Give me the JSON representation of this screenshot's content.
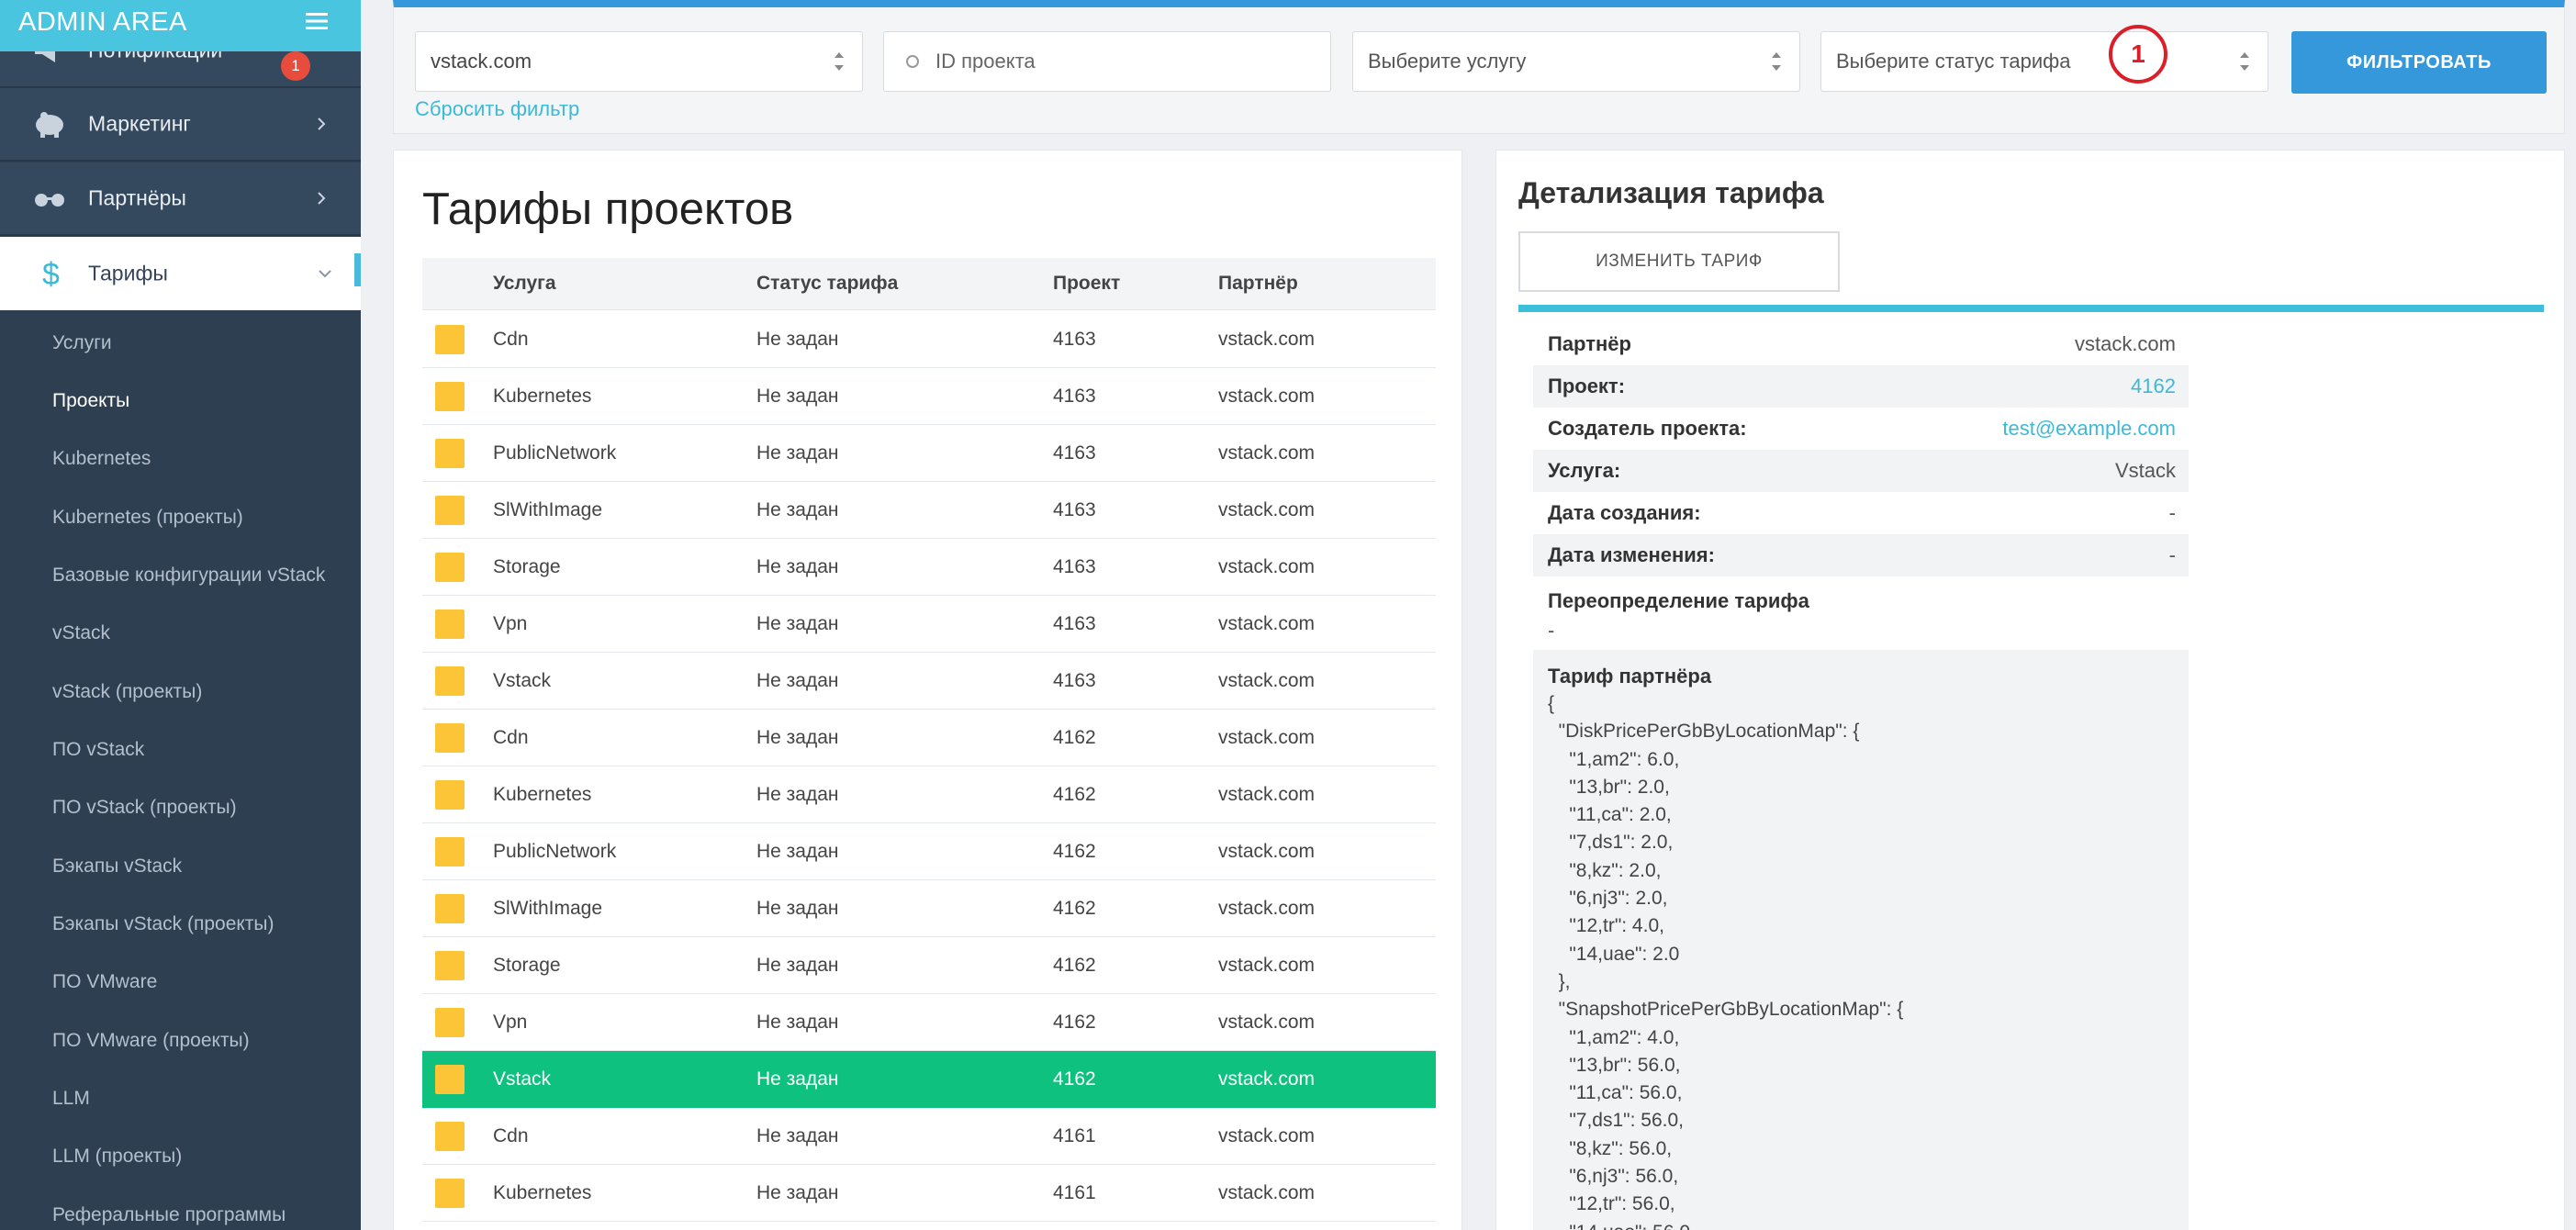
{
  "sidebar": {
    "header_title": "ADMIN AREA",
    "notifications": {
      "label": "Нотификации",
      "badge": "1"
    },
    "items": [
      {
        "label": "Маркетинг"
      },
      {
        "label": "Партнёры"
      },
      {
        "label": "Тарифы"
      }
    ],
    "sub_items": [
      "Услуги",
      "Проекты",
      "Kubernetes",
      "Kubernetes (проекты)",
      "Базовые конфигурации vStack",
      "vStack",
      "vStack (проекты)",
      "ПО vStack",
      "ПО vStack (проекты)",
      "Бэкапы vStack",
      "Бэкапы vStack (проекты)",
      "ПО VMware",
      "ПО VMware (проекты)",
      "LLM",
      "LLM (проекты)",
      "Реферальные программы"
    ]
  },
  "filter": {
    "partner_value": "vstack.com",
    "project_placeholder": "ID проекта",
    "service_placeholder": "Выберите услугу",
    "status_placeholder": "Выберите статус тарифа",
    "filter_button": "ФИЛЬТРОВАТЬ",
    "reset_link": "Сбросить фильтр",
    "marker_number": "1",
    "marker_color": "#d9202a"
  },
  "table": {
    "title": "Тарифы проектов",
    "headers": {
      "service": "Услуга",
      "status": "Статус тарифа",
      "project": "Проект",
      "partner": "Партнёр"
    },
    "selected_index": 13,
    "rows": [
      {
        "service": "Cdn",
        "status": "Не задан",
        "project": "4163",
        "partner": "vstack.com"
      },
      {
        "service": "Kubernetes",
        "status": "Не задан",
        "project": "4163",
        "partner": "vstack.com"
      },
      {
        "service": "PublicNetwork",
        "status": "Не задан",
        "project": "4163",
        "partner": "vstack.com"
      },
      {
        "service": "SlWithImage",
        "status": "Не задан",
        "project": "4163",
        "partner": "vstack.com"
      },
      {
        "service": "Storage",
        "status": "Не задан",
        "project": "4163",
        "partner": "vstack.com"
      },
      {
        "service": "Vpn",
        "status": "Не задан",
        "project": "4163",
        "partner": "vstack.com"
      },
      {
        "service": "Vstack",
        "status": "Не задан",
        "project": "4163",
        "partner": "vstack.com"
      },
      {
        "service": "Cdn",
        "status": "Не задан",
        "project": "4162",
        "partner": "vstack.com"
      },
      {
        "service": "Kubernetes",
        "status": "Не задан",
        "project": "4162",
        "partner": "vstack.com"
      },
      {
        "service": "PublicNetwork",
        "status": "Не задан",
        "project": "4162",
        "partner": "vstack.com"
      },
      {
        "service": "SlWithImage",
        "status": "Не задан",
        "project": "4162",
        "partner": "vstack.com"
      },
      {
        "service": "Storage",
        "status": "Не задан",
        "project": "4162",
        "partner": "vstack.com"
      },
      {
        "service": "Vpn",
        "status": "Не задан",
        "project": "4162",
        "partner": "vstack.com"
      },
      {
        "service": "Vstack",
        "status": "Не задан",
        "project": "4162",
        "partner": "vstack.com"
      },
      {
        "service": "Cdn",
        "status": "Не задан",
        "project": "4161",
        "partner": "vstack.com"
      },
      {
        "service": "Kubernetes",
        "status": "Не задан",
        "project": "4161",
        "partner": "vstack.com"
      }
    ]
  },
  "detail": {
    "title": "Детализация тарифа",
    "change_button": "ИЗМЕНИТЬ ТАРИФ",
    "fields": [
      {
        "key": "Партнёр",
        "value": "vstack.com",
        "link": false
      },
      {
        "key": "Проект:",
        "value": "4162",
        "link": true
      },
      {
        "key": "Создатель проекта:",
        "value": "test@example.com",
        "link": true
      },
      {
        "key": "Услуга:",
        "value": "Vstack",
        "link": false
      },
      {
        "key": "Дата создания:",
        "value": "-",
        "link": false
      },
      {
        "key": "Дата изменения:",
        "value": "-",
        "link": false
      }
    ],
    "override_label": "Переопределение тарифа",
    "override_value": "-",
    "partner_tariff_label": "Тариф партнёра",
    "partner_tariff_json": "{\n  \"DiskPricePerGbByLocationMap\": {\n    \"1,am2\": 6.0,\n    \"13,br\": 2.0,\n    \"11,ca\": 2.0,\n    \"7,ds1\": 2.0,\n    \"8,kz\": 2.0,\n    \"6,nj3\": 2.0,\n    \"12,tr\": 4.0,\n    \"14,uae\": 2.0\n  },\n  \"SnapshotPricePerGbByLocationMap\": {\n    \"1,am2\": 4.0,\n    \"13,br\": 56.0,\n    \"11,ca\": 56.0,\n    \"7,ds1\": 56.0,\n    \"8,kz\": 56.0,\n    \"6,nj3\": 56.0,\n    \"12,tr\": 56.0,\n    \"14,uae\": 56.0"
  },
  "colors": {
    "sidebar_bg": "#2f3f52",
    "header_accent": "#49c5e0",
    "primary_button": "#3498db",
    "selected_row": "#0ec17e",
    "row_square": "#fcc537",
    "link": "#3bb9d7"
  }
}
